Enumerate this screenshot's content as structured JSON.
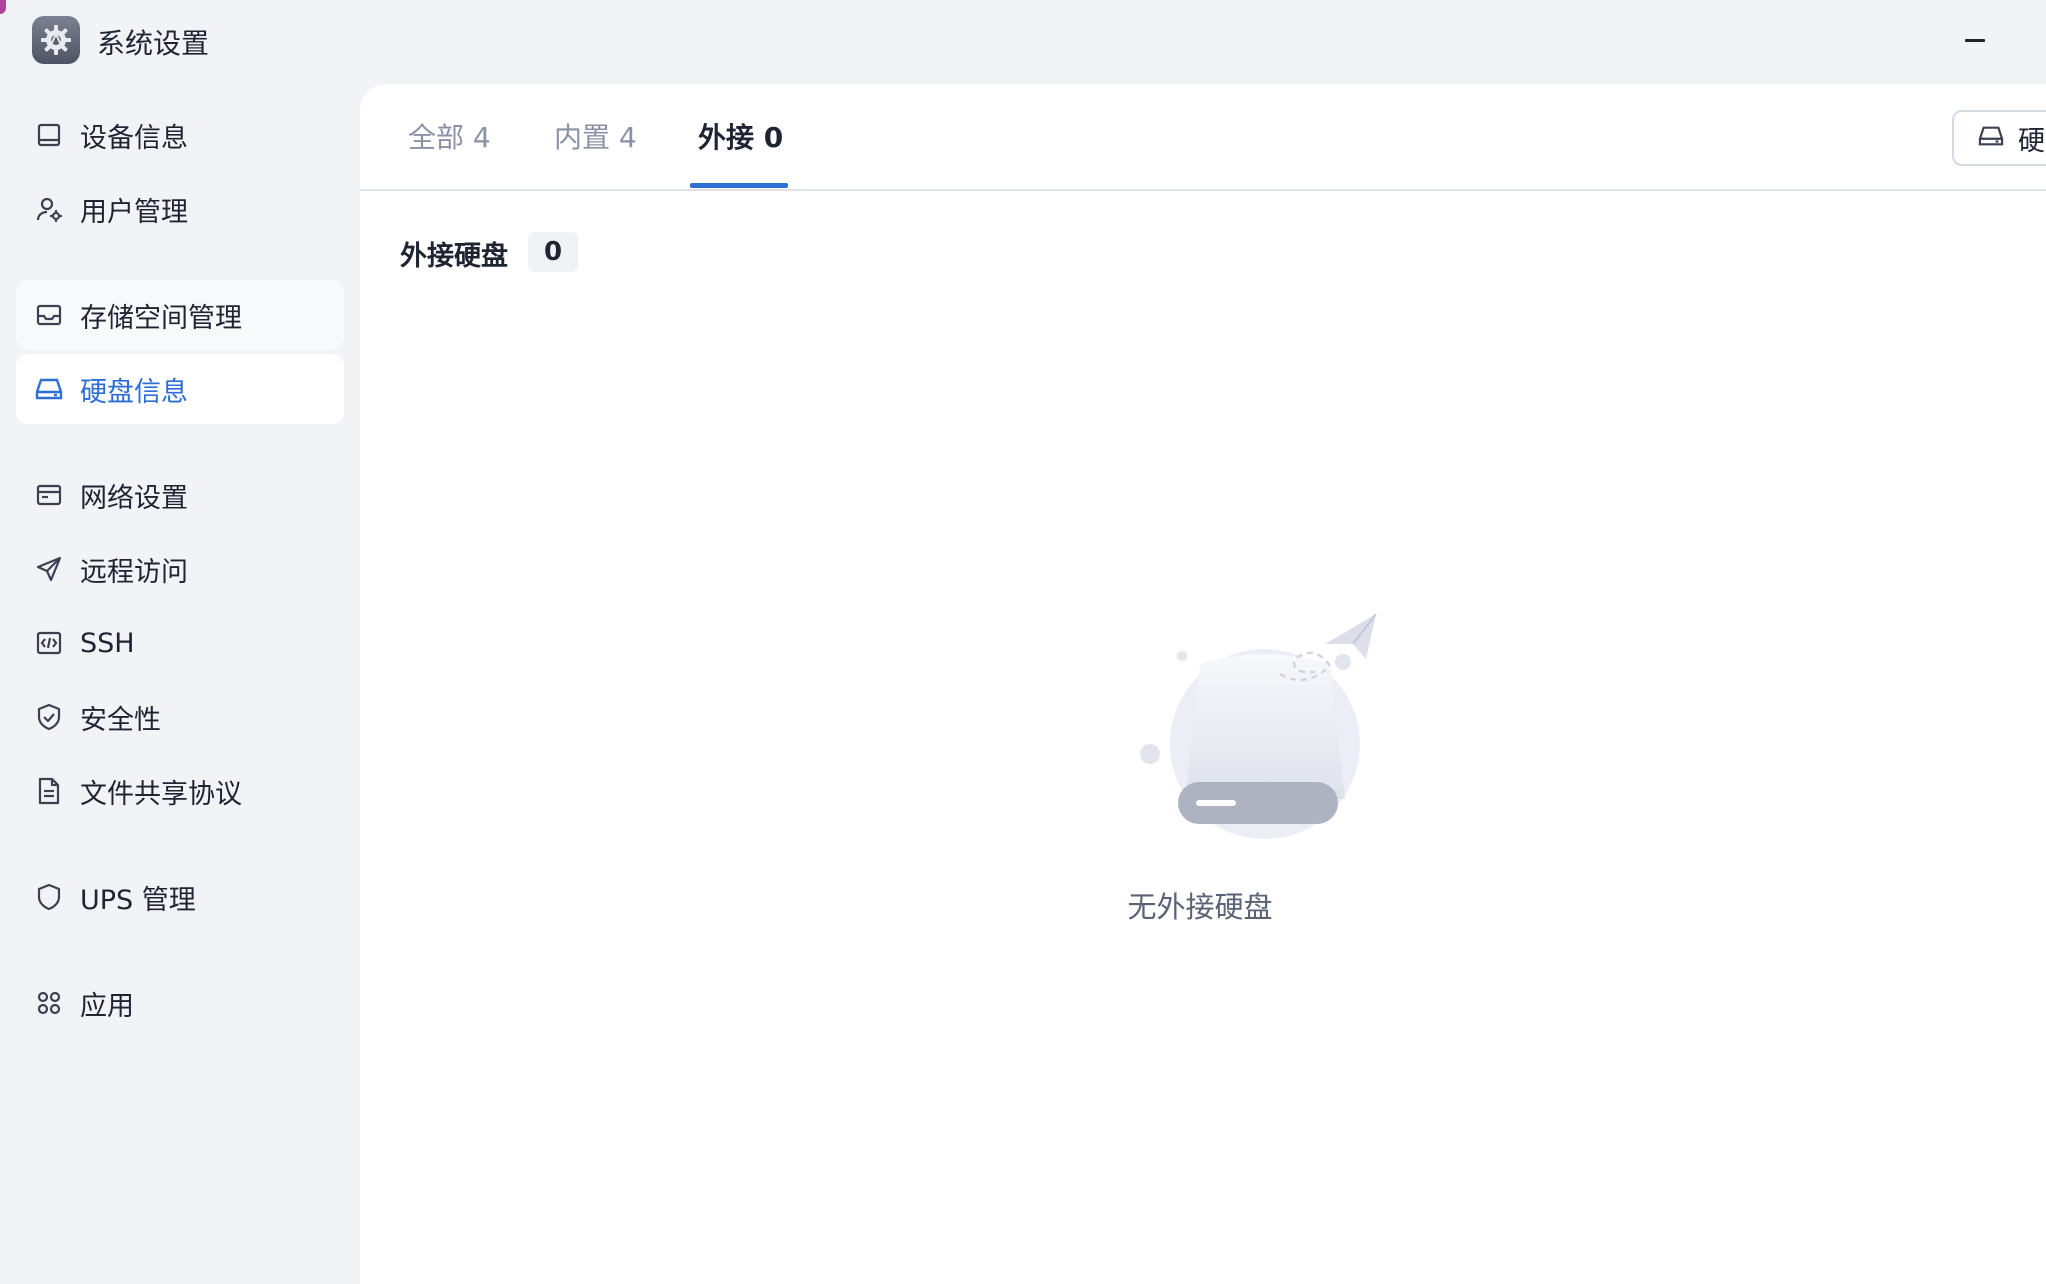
{
  "app": {
    "title": "系统设置",
    "icon": "gear-icon"
  },
  "window": {
    "minimize": "minimize-icon"
  },
  "sidebar": {
    "items": [
      {
        "label": "设备信息",
        "icon": "device-info-icon"
      },
      {
        "label": "用户管理",
        "icon": "user-settings-icon"
      },
      {
        "label": "存储空间管理",
        "icon": "storage-icon"
      },
      {
        "label": "硬盘信息",
        "icon": "hard-disk-icon",
        "active": true
      },
      {
        "label": "网络设置",
        "icon": "network-icon"
      },
      {
        "label": "远程访问",
        "icon": "paper-plane-icon"
      },
      {
        "label": "SSH",
        "icon": "code-icon"
      },
      {
        "label": "安全性",
        "icon": "shield-check-icon"
      },
      {
        "label": "文件共享协议",
        "icon": "document-icon"
      },
      {
        "label": "UPS 管理",
        "icon": "shield-icon"
      },
      {
        "label": "应用",
        "icon": "apps-icon"
      }
    ]
  },
  "tabs": [
    {
      "label": "全部 4"
    },
    {
      "label": "内置 4"
    },
    {
      "label": "外接 0",
      "active": true
    }
  ],
  "toolbar": {
    "disk_button_label": "硬"
  },
  "section": {
    "title": "外接硬盘",
    "count": "0"
  },
  "empty_state": {
    "message": "无外接硬盘"
  },
  "colors": {
    "accent": "#2d6fd6",
    "background": "#f2f3f7",
    "panel": "#ffffff"
  }
}
